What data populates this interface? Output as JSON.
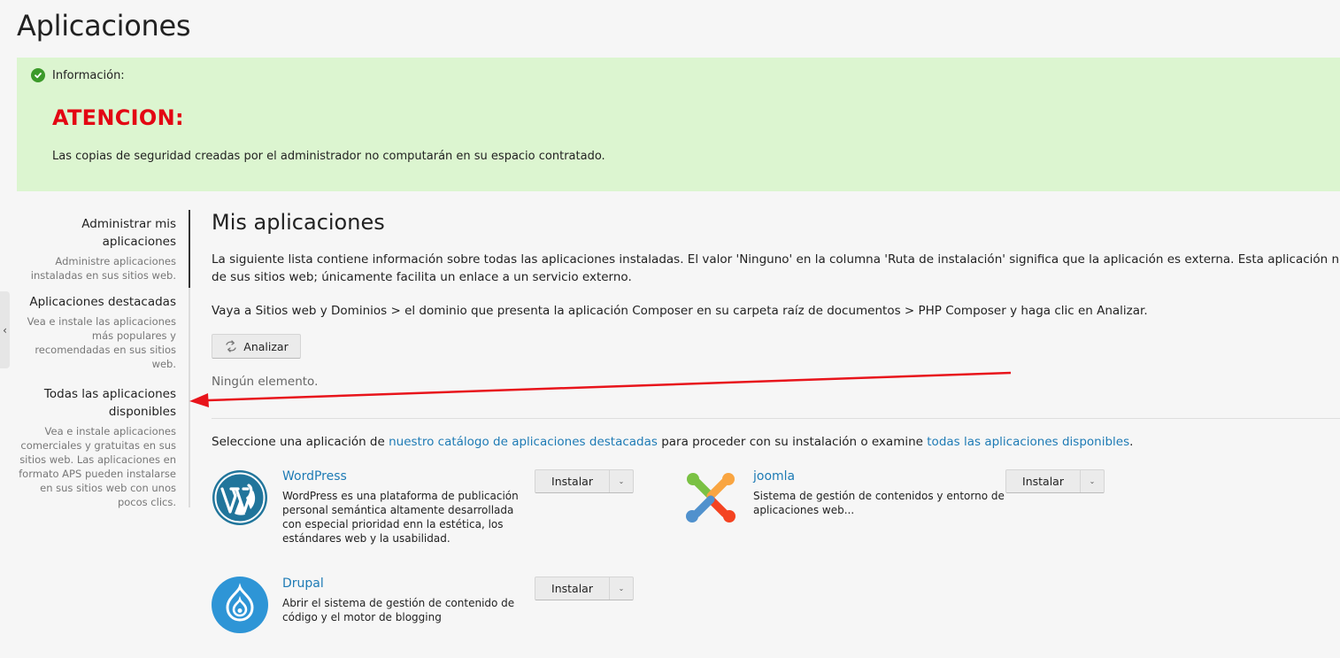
{
  "page": {
    "title": "Aplicaciones"
  },
  "info": {
    "header": "Información:",
    "attention": "ATENCION:",
    "message": "Las copias de seguridad creadas por el administrador no computarán en su espacio contratado.",
    "color": "#dcf5d0",
    "attention_color": "#e30613"
  },
  "sidebar": {
    "items": [
      {
        "title": "Administrar mis aplicaciones",
        "description": "Administre aplicaciones instaladas en sus sitios web.",
        "active": true
      },
      {
        "title": "Aplicaciones destacadas",
        "description": "Vea e instale las aplicaciones más populares y recomendadas en sus sitios web.",
        "active": false
      },
      {
        "title": "Todas las aplicaciones disponibles",
        "description": "Vea e instale aplicaciones comerciales y gratuitas en sus sitios web. Las aplicaciones en formato APS pueden instalarse en sus sitios web con unos pocos clics.",
        "active": false
      }
    ],
    "collapse_icon": "chevron-left-icon"
  },
  "main": {
    "title": "Mis aplicaciones",
    "description_line1": "La siguiente lista contiene información sobre todas las aplicaciones instaladas. El valor 'Ninguno' en la columna 'Ruta de instalación' significa que la aplicación es externa. Esta aplicación no puede i",
    "description_line2": "de sus sitios web; únicamente facilita un enlace a un servicio externo.",
    "instructions": "Vaya a Sitios web y Dominios > el dominio que presenta la aplicación Composer en su carpeta raíz de documentos > PHP Composer y haga clic en Analizar.",
    "analyze_label": "Analizar",
    "empty_text": "Ningún elemento.",
    "catalog_prefix": "Seleccione una aplicación de ",
    "catalog_link1": "nuestro catálogo de aplicaciones destacadas",
    "catalog_middle": " para proceder con su instalación o examine ",
    "catalog_link2": "todas las aplicaciones disponibles",
    "catalog_suffix": "."
  },
  "apps": [
    {
      "name": "WordPress",
      "description": "WordPress es una plataforma de publicación personal semántica altamente desarrollada con especial prioridad enn la estética, los estándares web y la usabilidad.",
      "install_label": "Instalar",
      "icon": "wordpress-logo"
    },
    {
      "name": "joomla",
      "description": "Sistema de gestión de contenidos y entorno de aplicaciones web...",
      "install_label": "Instalar",
      "icon": "joomla-logo"
    },
    {
      "name": "Drupal",
      "description": "Abrir el sistema de gestión de contenido de código y el motor de blogging",
      "install_label": "Instalar",
      "icon": "drupal-logo"
    }
  ],
  "annotation": {
    "color": "#e8141b"
  }
}
